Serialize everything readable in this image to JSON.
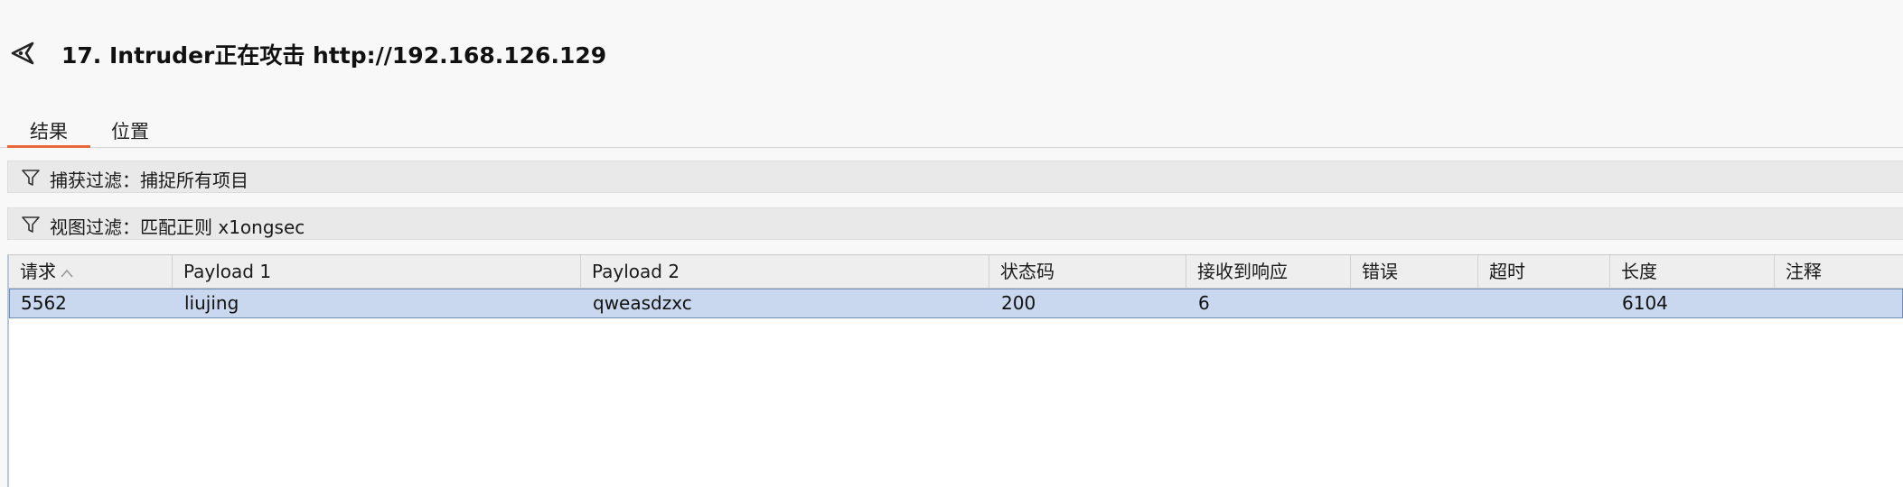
{
  "header": {
    "title": "17. Intruder正在攻击 http://192.168.126.129",
    "back_icon": "send-arrow-back-icon"
  },
  "tabs": [
    {
      "label": "结果",
      "active": true
    },
    {
      "label": "位置",
      "active": false
    }
  ],
  "filters": {
    "capture": {
      "text": "捕获过滤：捕捉所有项目",
      "icon": "funnel-icon"
    },
    "view": {
      "text": "视图过滤：匹配正则 x1ongsec",
      "icon": "funnel-icon"
    }
  },
  "table": {
    "columns": [
      "请求",
      "Payload 1",
      "Payload 2",
      "状态码",
      "接收到响应",
      "错误",
      "超时",
      "长度",
      "注释"
    ],
    "sort_column": "请求",
    "sort_direction": "ascending",
    "rows": [
      {
        "selected": true,
        "cells": [
          "5562",
          "liujing",
          "qweasdzxc",
          "200",
          "6",
          "",
          "",
          "6104",
          ""
        ]
      }
    ]
  },
  "colors": {
    "accent_tab_underline": "#e8683a",
    "selected_row_bg": "#c9d8ee",
    "selected_row_border": "#6f8fb8",
    "filter_bar_bg": "#e9e9e9",
    "header_bg": "#f8f8f8"
  }
}
